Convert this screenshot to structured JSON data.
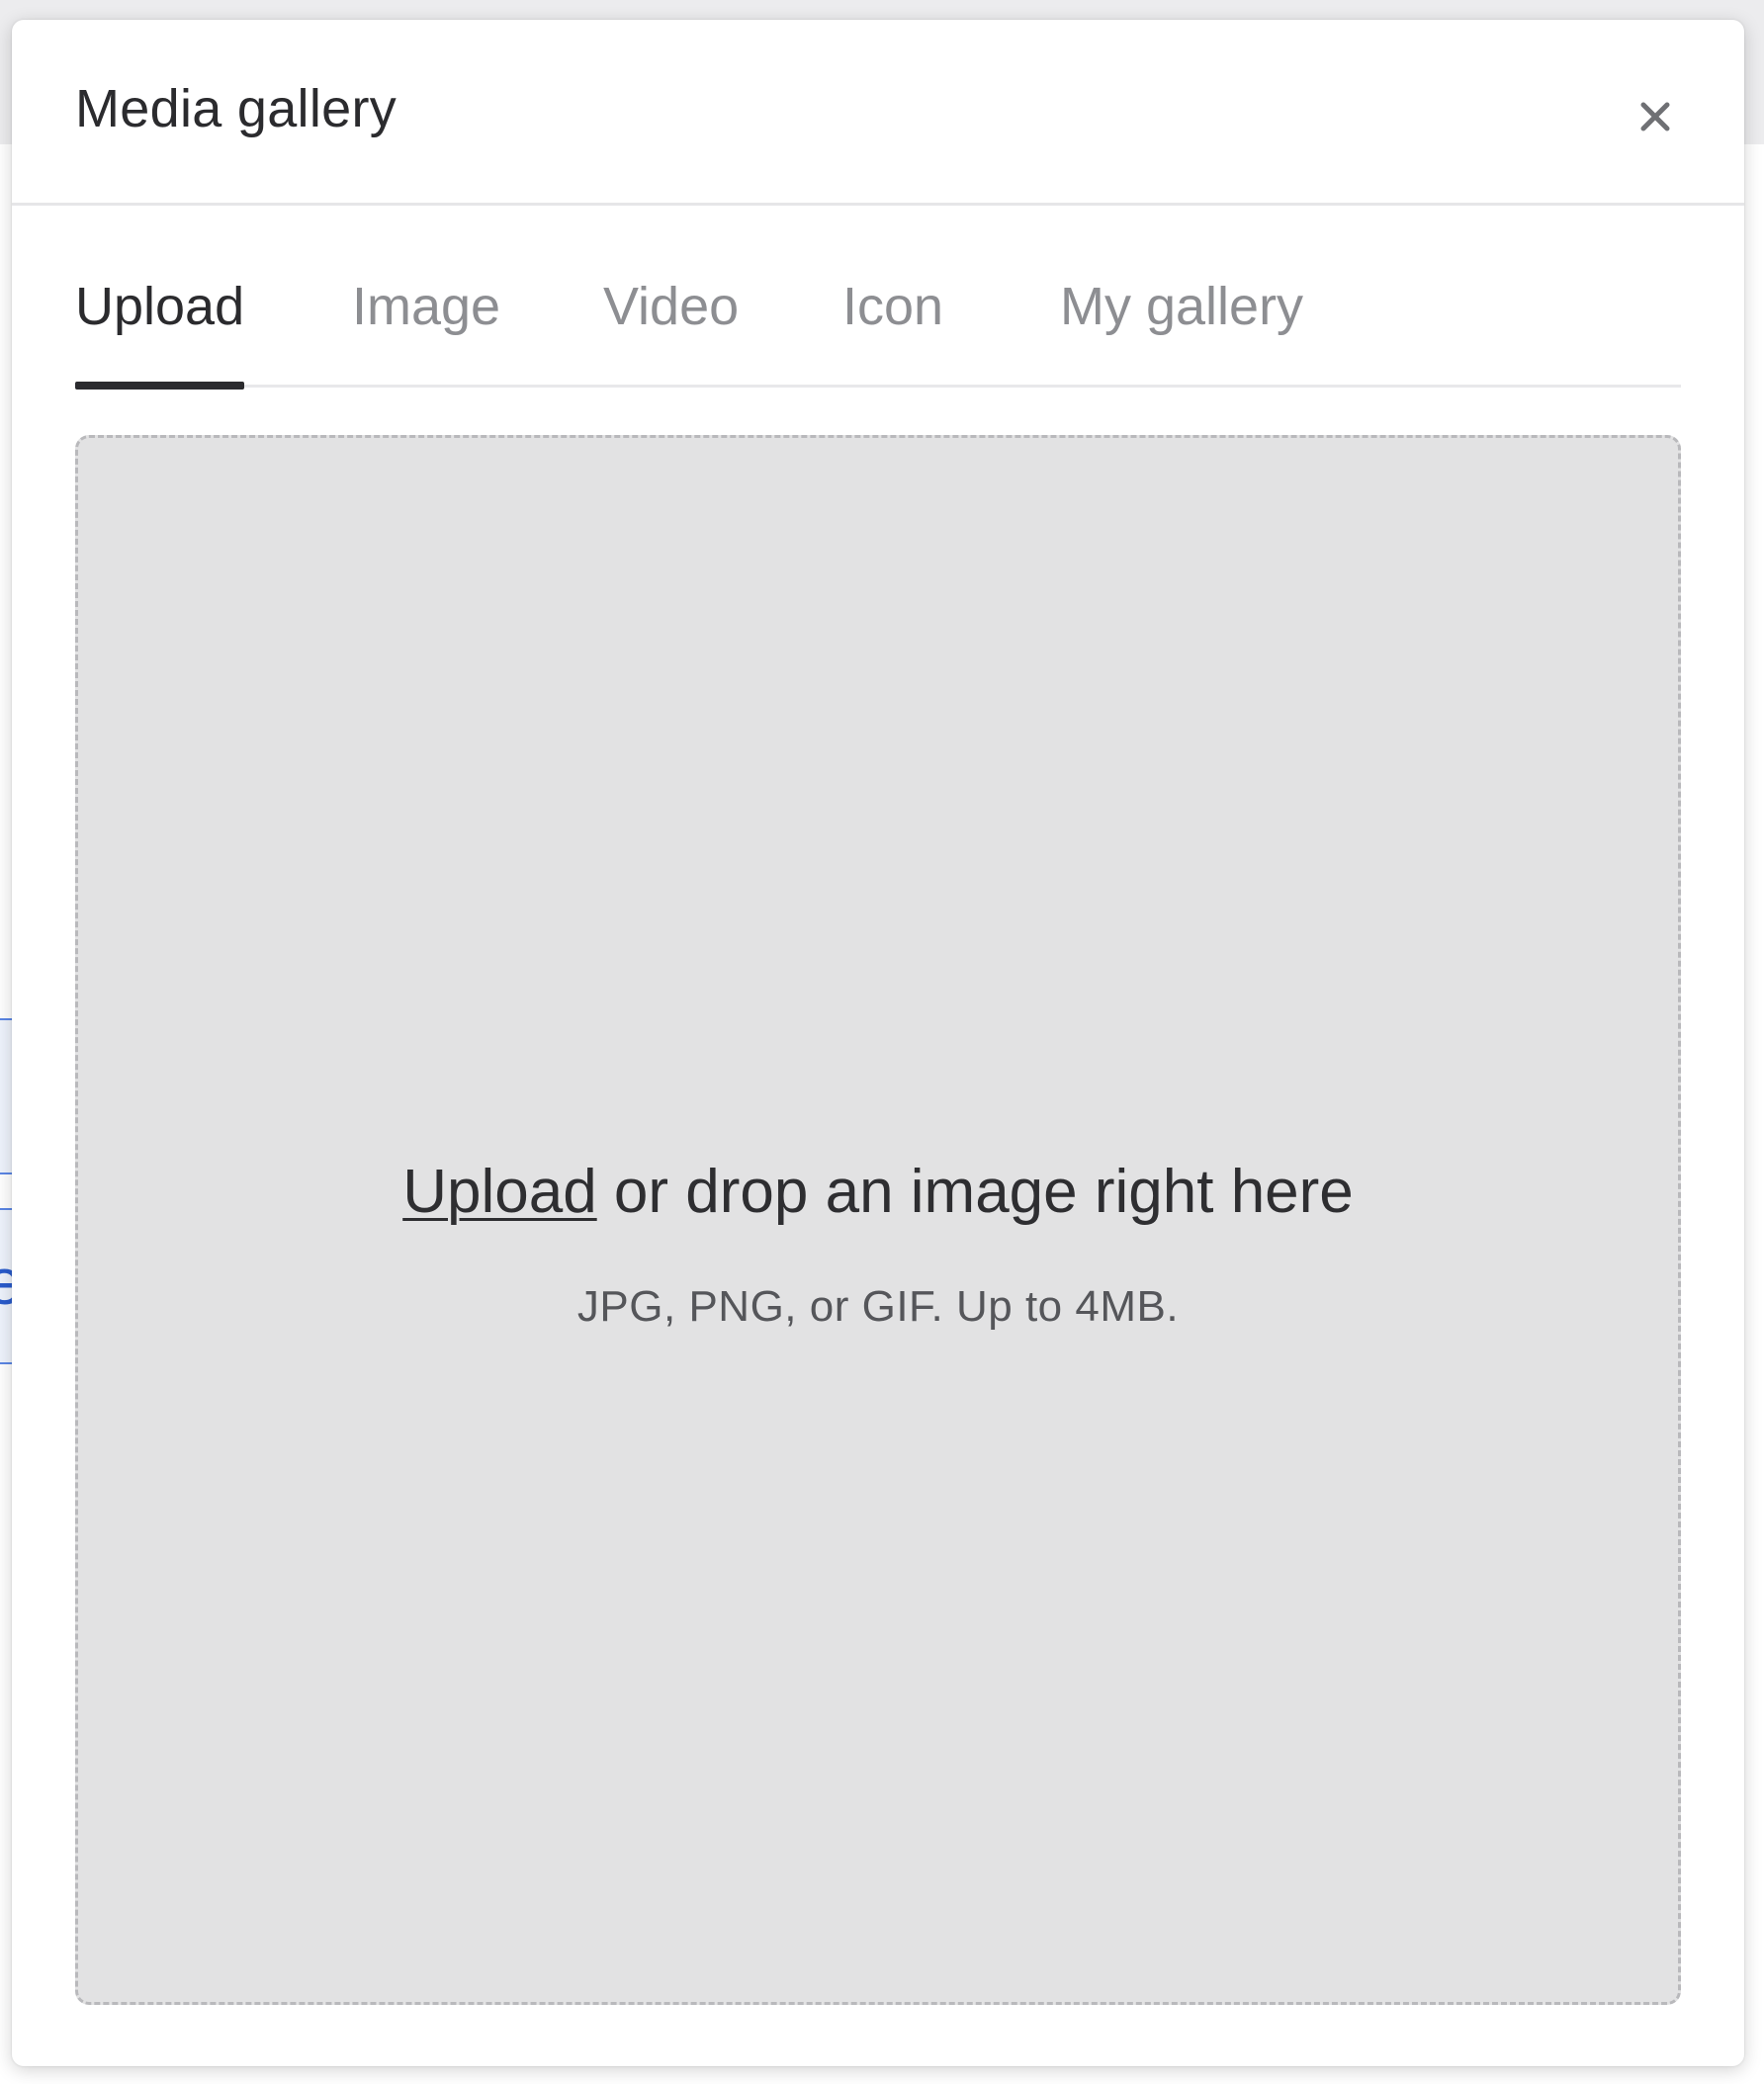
{
  "modal": {
    "title": "Media gallery",
    "close_icon": "close-icon"
  },
  "tabs": [
    {
      "label": "Upload",
      "active": true
    },
    {
      "label": "Image",
      "active": false
    },
    {
      "label": "Video",
      "active": false
    },
    {
      "label": "Icon",
      "active": false
    },
    {
      "label": "My gallery",
      "active": false
    }
  ],
  "dropzone": {
    "link_text": "Upload",
    "text_rest": " or drop an image right here",
    "hint": "JPG, PNG, or GIF. Up to 4MB."
  },
  "background": {
    "partial_glyph": "e"
  },
  "colors": {
    "title_text": "#2b2b2e",
    "inactive_tab": "#8d8e92",
    "dropzone_bg": "#e2e2e3",
    "background_link": "#2a5ccc"
  }
}
